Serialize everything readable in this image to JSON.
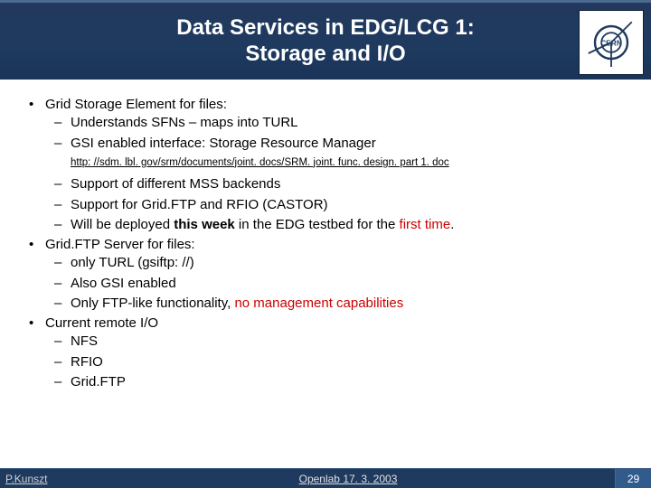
{
  "header": {
    "title_line1": "Data Services in EDG/LCG 1:",
    "title_line2": "Storage and I/O",
    "logo_name": "CERN"
  },
  "content": {
    "b1": "Grid Storage Element for files:",
    "b1_d1": "Understands SFNs – maps into TURL",
    "b1_d2": "GSI enabled interface: Storage Resource Manager",
    "b1_url": "http: //sdm. lbl. gov/srm/documents/joint. docs/SRM. joint. func. design. part 1. doc",
    "b1_d3": "Support of different MSS backends",
    "b1_d4": "Support for Grid.FTP and RFIO (CASTOR)",
    "b1_d5_pre": "Will be deployed ",
    "b1_d5_bold": "this week",
    "b1_d5_mid": " in the EDG testbed for the ",
    "b1_d5_red": "first time",
    "b1_d5_post": ".",
    "b2": "Grid.FTP Server for files:",
    "b2_d1": "only TURL (gsiftp: //)",
    "b2_d2": "Also GSI enabled",
    "b2_d3_pre": "Only FTP-like functionality, ",
    "b2_d3_red": "no management capabilities",
    "b3": "Current remote I/O",
    "b3_d1": "NFS",
    "b3_d2": "RFIO",
    "b3_d3": "Grid.FTP"
  },
  "footer": {
    "author": "P.Kunszt",
    "event": "Openlab  17. 3. 2003",
    "page": "29"
  }
}
